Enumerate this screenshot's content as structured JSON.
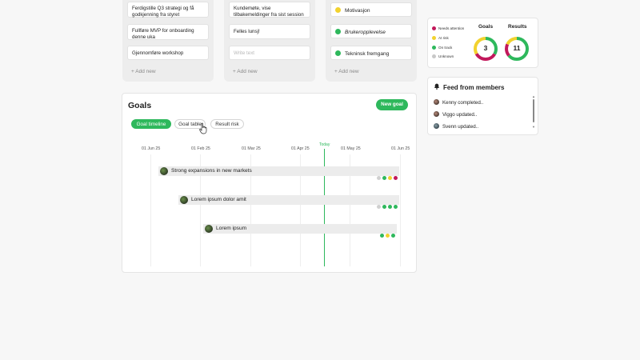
{
  "columns": [
    {
      "cards": [
        "Ferdigstille Q3 strategi og få godkjenning fra styret",
        "Fullføre MVP for onboarding denne uka",
        "Gjennomføre workshop"
      ],
      "add_label": "+ Add new"
    },
    {
      "cards": [
        "Kundemøte, vise tilbakemeldinger fra sist session",
        "Felles lunsj!"
      ],
      "input_placeholder": "Write text",
      "add_label": "+ Add new"
    },
    {
      "status_cards": [
        {
          "label": "Motivasjon",
          "color": "#f2d22e",
          "italic": false
        },
        {
          "label": "Brukeropplevelse",
          "color": "#2eb85c",
          "italic": true
        },
        {
          "label": "Tekninsk fremgang",
          "color": "#2eb85c",
          "italic": false
        }
      ],
      "add_label": "+ Add new"
    }
  ],
  "goals_panel": {
    "title": "Goals",
    "new_goal_label": "New goal",
    "tabs": [
      {
        "label": "Goal timeline",
        "active": true
      },
      {
        "label": "Goal table",
        "active": false
      },
      {
        "label": "Result risk",
        "active": false
      }
    ],
    "months": [
      "01 Jun 25",
      "01 Feb 25",
      "01 Mar 25",
      "01 Apr 25",
      "01 May 25",
      "01 Jun 25"
    ],
    "today_label": "Today",
    "goals": [
      {
        "label": "Strong expansions in new markets",
        "dots": [
          "#d0d0d0",
          "#2eb85c",
          "#f2d22e",
          "#c2185b"
        ]
      },
      {
        "label": "Lorem ipsum dolor amit",
        "dots": [
          "#d0d0d0",
          "#2eb85c",
          "#2eb85c",
          "#2eb85c"
        ]
      },
      {
        "label": "Lorem ipsum",
        "dots": [
          "#2eb85c",
          "#f2d22e",
          "#2eb85c"
        ]
      }
    ]
  },
  "stats": {
    "legend": [
      {
        "label": "Needs attention",
        "color": "#c2185b"
      },
      {
        "label": "At risk",
        "color": "#f2d22e"
      },
      {
        "label": "On track",
        "color": "#2eb85c"
      },
      {
        "label": "Unknown",
        "color": "#c8c8c8"
      }
    ],
    "goals_title": "Goals",
    "results_title": "Results",
    "goals_count": "3",
    "results_count": "11"
  },
  "feed": {
    "title": "Feed from members",
    "items": [
      "Kenny completed..",
      "Viggo updated..",
      "Svenn updated.."
    ]
  }
}
